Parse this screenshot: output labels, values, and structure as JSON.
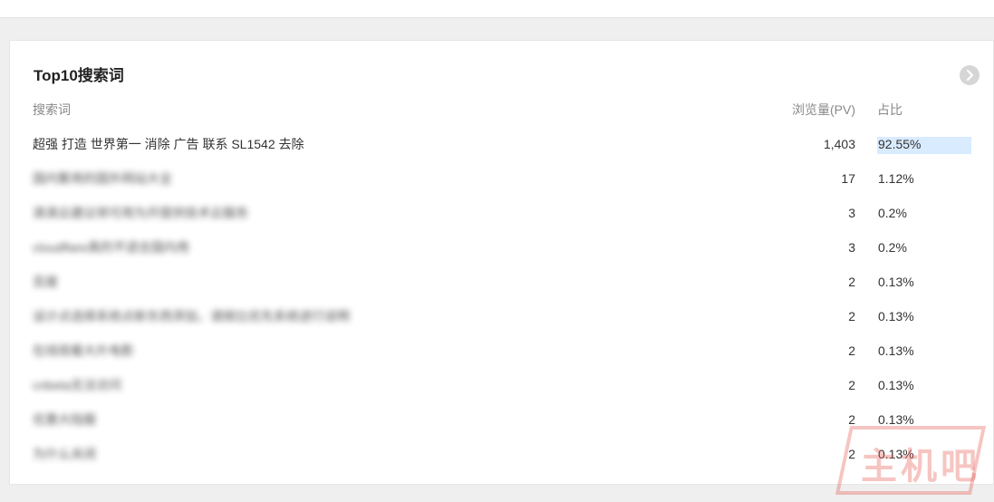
{
  "panel": {
    "title": "Top10搜索词",
    "more_icon": "chevron-right-circle-icon"
  },
  "table": {
    "headers": {
      "keyword": "搜索词",
      "pv": "浏览量(PV)",
      "ratio": "占比"
    },
    "rows": [
      {
        "keyword": "超强 打造 世界第一 消除 广告 联系 SL1542 去除",
        "pv": "1,403",
        "ratio": "92.55%",
        "ratio_value": 0.9255,
        "blurred": false
      },
      {
        "keyword": "国内繁用的国外网站大全",
        "pv": "17",
        "ratio": "1.12%",
        "ratio_value": 0.0112,
        "blurred": true
      },
      {
        "keyword": "滴滴云建议将可用为开提供技术云服务",
        "pv": "3",
        "ratio": "0.2%",
        "ratio_value": 0.002,
        "blurred": true
      },
      {
        "keyword": "cloudflare真的不适合国内用",
        "pv": "3",
        "ratio": "0.2%",
        "ratio_value": 0.002,
        "blurred": true
      },
      {
        "keyword": "百度",
        "pv": "2",
        "ratio": "0.13%",
        "ratio_value": 0.0013,
        "blurred": true
      },
      {
        "keyword": "设计点选择系统点新东西添加，请按比优先系统进行说明",
        "pv": "2",
        "ratio": "0.13%",
        "ratio_value": 0.0013,
        "blurred": true
      },
      {
        "keyword": "在线观看大片电影",
        "pv": "2",
        "ratio": "0.13%",
        "ratio_value": 0.0013,
        "blurred": true
      },
      {
        "keyword": "cnbeta无法访问",
        "pv": "2",
        "ratio": "0.13%",
        "ratio_value": 0.0013,
        "blurred": true
      },
      {
        "keyword": "优惠大陆服",
        "pv": "2",
        "ratio": "0.13%",
        "ratio_value": 0.0013,
        "blurred": true
      },
      {
        "keyword": "为什么关闭",
        "pv": "2",
        "ratio": "0.13%",
        "ratio_value": 0.0013,
        "blurred": true
      }
    ]
  },
  "watermark": {
    "text": "主机吧",
    "color": "#e65a50"
  },
  "colors": {
    "ratio_bar": "#d9ebff",
    "page_bg": "#efefef"
  }
}
